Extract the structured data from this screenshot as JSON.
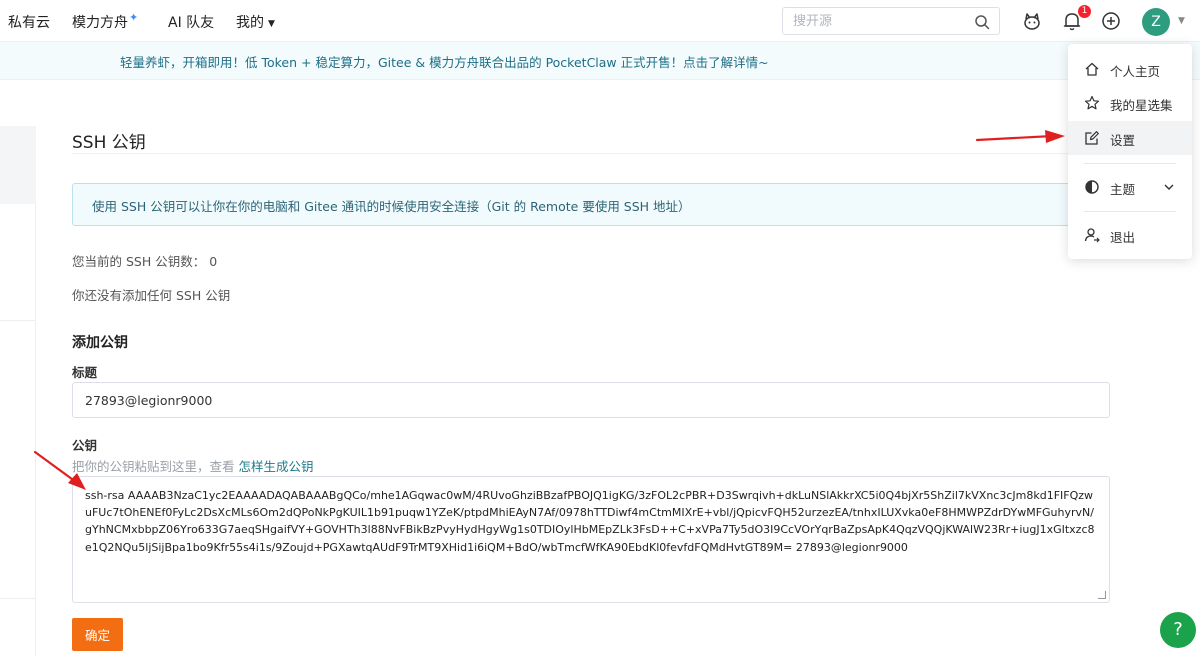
{
  "nav": {
    "brand": "私有云",
    "items": [
      "模力方舟",
      "AI 队友",
      "我的"
    ],
    "search_placeholder": "搜开源",
    "notification_count": "1",
    "avatar_letter": "Z"
  },
  "announcement": "轻量养虾，开箱即用！低 Token + 稳定算力，Gitee & 模力方舟联合出品的 PocketClaw 正式开售！点击了解详情~",
  "page": {
    "title": "SSH 公钥",
    "info": "使用 SSH 公钥可以让你在你的电脑和 Gitee 通讯的时候使用安全连接（Git 的 Remote 要使用 SSH 地址）",
    "count_label": "您当前的 SSH 公钥数：",
    "count_value": "0",
    "empty": "你还没有添加任何 SSH 公钥",
    "add_heading": "添加公钥",
    "title_label": "标题",
    "title_value": "27893@legionr9000",
    "key_label": "公钥",
    "key_hint": "把你的公钥粘贴到这里，查看 ",
    "key_hint_link": "怎样生成公钥",
    "key_value": "ssh-rsa AAAAB3NzaC1yc2EAAAADAQABAAABgQCo/mhe1AGqwac0wM/4RUvoGhziBBzafPBOJQ1igKG/3zFOL2cPBR+D3Swrqivh+dkLuNSlAkkrXC5i0Q4bjXr5ShZil7kVXnc3cJm8kd1FIFQzwuFUc7tOhENEf0FyLc2DsXcMLs6Om2dQPoNkPgKUIL1b91puqw1YZeK/ptpdMhiEAyN7Af/0978hTTDiwf4mCtmMIXrE+vbl/jQpicvFQH52urzezEA/tnhxILUXvka0eF8HMWPZdrDYwMFGuhyrvN/gYhNCMxbbpZ06Yro633G7aeqSHgaifVY+GOVHTh3l88NvFBikBzPvyHydHgyWg1s0TDIOylHbMEpZLk3FsD++C+xVPa7Ty5dO3I9CcVOrYqrBaZpsApK4QqzVQQjKWAlW23Rr+iugJ1xGItxzc8e1Q2NQu5ljSijBpa1bo9Kfr55s4i1s/9Zoujd+PGXawtqAUdF9TrMT9XHid1i6iQM+BdO/wbTmcfWfKA90EbdKl0fevfdFQMdHvtGT89M= 27893@legionr9000",
    "confirm": "确定"
  },
  "menu": {
    "items": [
      "个人主页",
      "我的星选集",
      "设置",
      "主题",
      "退出"
    ]
  },
  "help": "?",
  "colors": {
    "accent": "#f36d12",
    "avatar": "#2d9c7f",
    "arrow": "#e02020"
  }
}
